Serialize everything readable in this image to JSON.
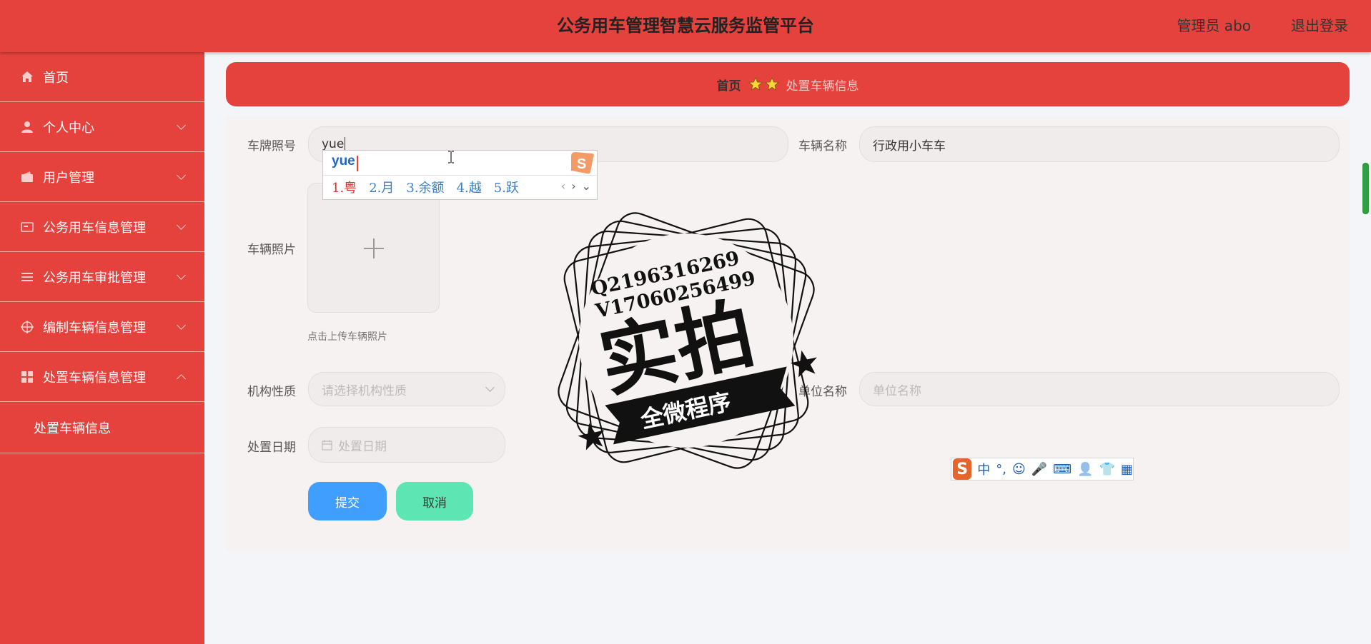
{
  "header": {
    "title": "公务用车管理智慧云服务监管平台",
    "user": "管理员 abo",
    "logout": "退出登录"
  },
  "sidebar": {
    "items": [
      {
        "label": "首页",
        "icon": "home-icon"
      },
      {
        "label": "个人中心",
        "icon": "person-icon"
      },
      {
        "label": "用户管理",
        "icon": "wallet-icon"
      },
      {
        "label": "公务用车信息管理",
        "icon": "card-icon"
      },
      {
        "label": "公务用车审批管理",
        "icon": "list-icon"
      },
      {
        "label": "编制车辆信息管理",
        "icon": "target-icon"
      },
      {
        "label": "处置车辆信息管理",
        "icon": "grid-icon"
      }
    ],
    "submenu": {
      "label": "处置车辆信息"
    }
  },
  "breadcrumb": {
    "home": "首页",
    "current": "处置车辆信息"
  },
  "form": {
    "plate_label": "车牌照号",
    "plate_value": "yue",
    "name_label": "车辆名称",
    "name_value": "行政用小车车",
    "photo_label": "车辆照片",
    "photo_hint": "点击上传车辆照片",
    "org_label": "机构性质",
    "org_placeholder": "请选择机构性质",
    "unit_label": "单位名称",
    "unit_placeholder": "单位名称",
    "date_label": "处置日期",
    "date_placeholder": "处置日期",
    "submit": "提交",
    "cancel": "取消"
  },
  "ime": {
    "composition": "yue",
    "candidates": [
      "1.粤",
      "2.月",
      "3.余额",
      "4.越",
      "5.跃"
    ],
    "logo": "S",
    "status_items": [
      "中",
      "°,",
      "☺",
      "🎤",
      "⌨",
      "👤",
      "👕",
      "▦"
    ]
  },
  "stamp": {
    "line1": "Q2196316269",
    "line2": "V17060256499",
    "main": "实拍",
    "banner": "全微程序"
  }
}
